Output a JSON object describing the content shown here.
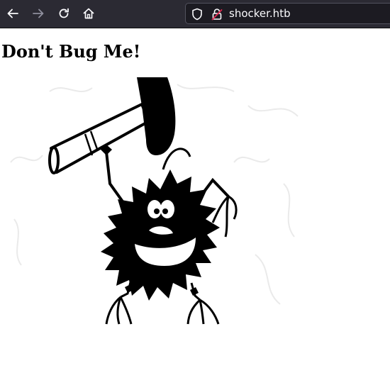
{
  "browser": {
    "url": "shocker.htb",
    "icons": [
      "back-arrow-icon",
      "forward-arrow-icon",
      "reload-icon",
      "home-icon",
      "shield-icon",
      "insecure-lock-icon"
    ]
  },
  "page": {
    "heading": "Don't Bug Me!",
    "image": {
      "subject": "bug-with-hammer",
      "icon": "bug-illustration"
    }
  },
  "colors": {
    "toolbar_bg": "#2b2a33",
    "urlbar_bg": "#1c1b22",
    "urlbar_text": "#fbfbfe",
    "icon_active": "#fbfbfe",
    "icon_disabled": "#8f8f9d",
    "insecure_accent": "#e22850"
  }
}
